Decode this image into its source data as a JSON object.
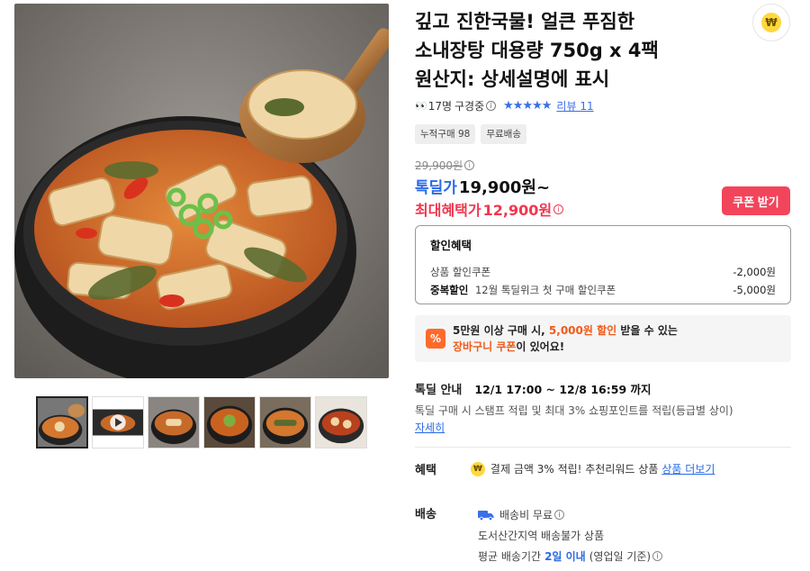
{
  "product": {
    "title_lines": [
      "깊고 진한국물! 얼큰 푸짐한",
      "소내장탕 대용량 750g x 4팩",
      "원산지: 상세설명에 표시"
    ],
    "viewers_count": "17명",
    "viewers_suffix": "구경중",
    "rating_stars": "★★★★★",
    "review_label": "리뷰 11",
    "tags": [
      "누적구매 98",
      "무료배송"
    ]
  },
  "point_icon": {
    "icon": "won-coin-icon",
    "glyph": "₩"
  },
  "pricing": {
    "original_price": "29,900원",
    "deal_label": "톡딜가",
    "deal_price": "19,900원~",
    "max_benefit_label": "최대혜택가",
    "max_benefit_price": "12,900원",
    "coupon_button": "쿠폰 받기"
  },
  "discount_box": {
    "title": "할인혜택",
    "rows": [
      {
        "label": "상품 할인쿠폰",
        "strong": "",
        "amount": "-2,000원"
      },
      {
        "label": "12월 톡딜위크 첫 구매 할인쿠폰",
        "strong": "중복할인",
        "amount": "-5,000원"
      }
    ]
  },
  "cart_banner": {
    "icon": "percent-icon",
    "part1": "5만원 이상 구매 시, ",
    "highlight1": "5,000원 할인",
    "part2": " 받을 수 있는",
    "highlight2": "장바구니 쿠폰",
    "part3": "이 있어요!"
  },
  "deal_info": {
    "label": "톡딜 안내",
    "period": "12/1 17:00 ~ 12/8 16:59 까지",
    "description": "톡딜 구매 시 스탬프 적립 및 최대 3% 쇼핑포인트를 적립(등급별 상이)",
    "more_link": "자세히"
  },
  "benefit": {
    "label": "혜택",
    "text": "결제 금액 3% 적립! 추천리워드 상품",
    "link": "상품 더보기"
  },
  "shipping": {
    "label": "배송",
    "fee": "배송비 무료",
    "restriction": "도서산간지역 배송불가 상품",
    "avg_prefix": "평균 배송기간",
    "avg_days": "2일 이내",
    "avg_suffix": "(영업일 기준)"
  },
  "colors": {
    "deal_blue": "#2a6ae8",
    "sale_red": "#f0374f",
    "coupon_button": "#f2455b",
    "cart_orange": "#f05a1a"
  }
}
